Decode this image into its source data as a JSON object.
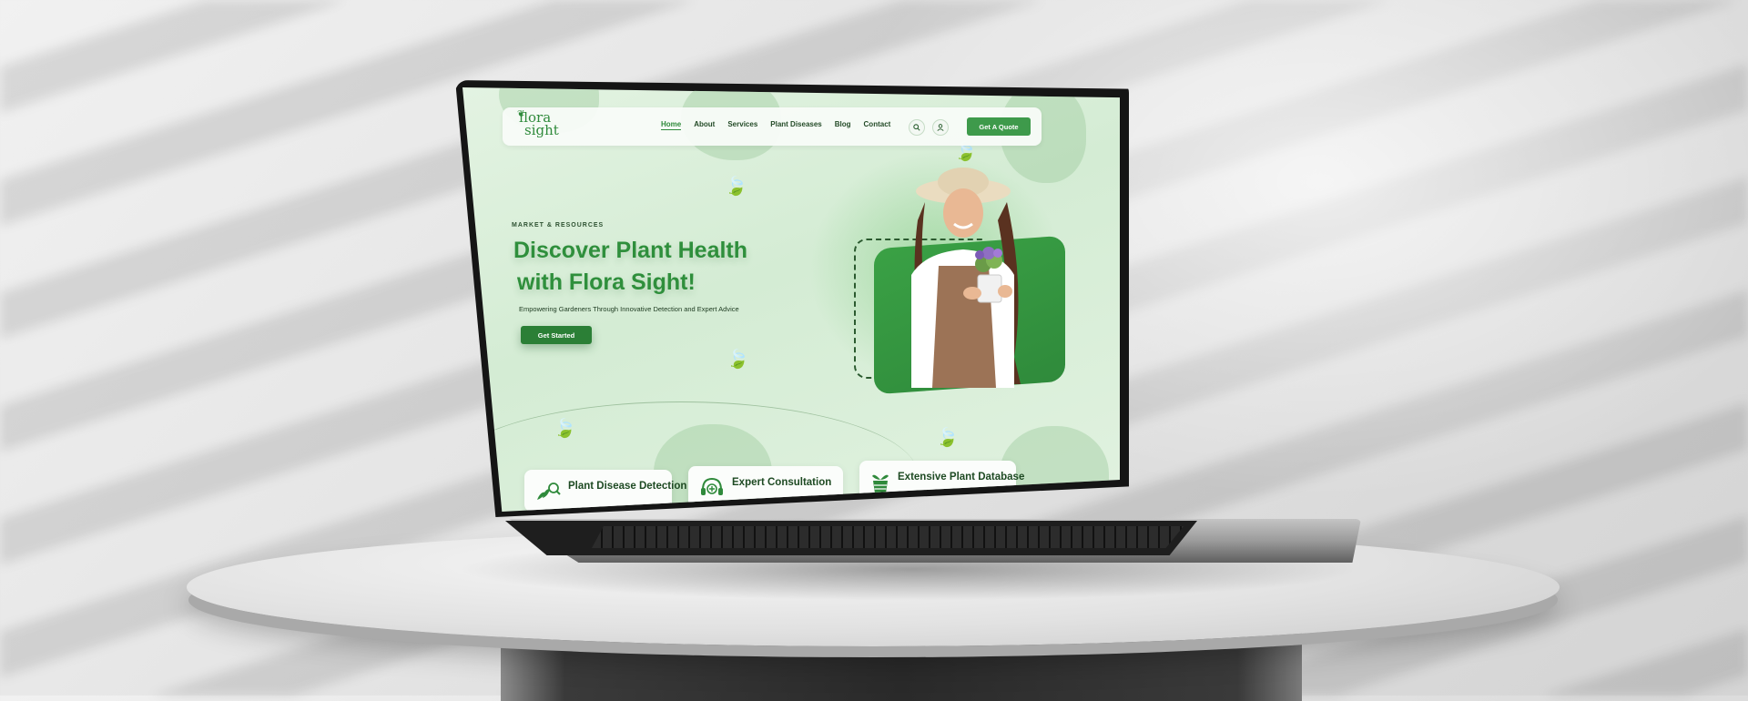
{
  "site": {
    "logo": {
      "line1": "flora",
      "line2": "sight"
    },
    "nav": {
      "links": [
        "Home",
        "About",
        "Services",
        "Plant Diseases",
        "Blog",
        "Contact"
      ],
      "active": "Home",
      "quote_button": "Get A Quote",
      "icons": [
        "search-icon",
        "user-icon"
      ]
    },
    "hero": {
      "eyebrow": "MARKET & RESOURCES",
      "title_line1": "Discover Plant Health",
      "title_line2": "with Flora Sight!",
      "subtitle": "Empowering Gardeners Through Innovative Detection and Expert Advice",
      "cta": "Get Started"
    },
    "features": [
      {
        "label": "Plant Disease Detection",
        "icon": "plant-magnifier-icon"
      },
      {
        "label": "Expert Consultation",
        "icon": "headset-support-icon"
      },
      {
        "label": "Extensive Plant Database",
        "icon": "potted-plant-icon"
      }
    ]
  },
  "colors": {
    "brand_green": "#2f8f3c",
    "button_green": "#3e9a4b",
    "page_background": "#d9efd8"
  }
}
